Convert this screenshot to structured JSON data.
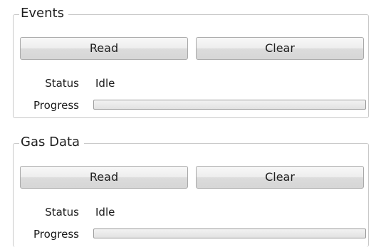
{
  "events": {
    "title": "Events",
    "read_label": "Read",
    "clear_label": "Clear",
    "status_label": "Status",
    "status_value": "Idle",
    "progress_label": "Progress",
    "progress": 0
  },
  "gas_data": {
    "title": "Gas Data",
    "read_label": "Read",
    "clear_label": "Clear",
    "status_label": "Status",
    "status_value": "Idle",
    "progress_label": "Progress",
    "progress": 0
  }
}
